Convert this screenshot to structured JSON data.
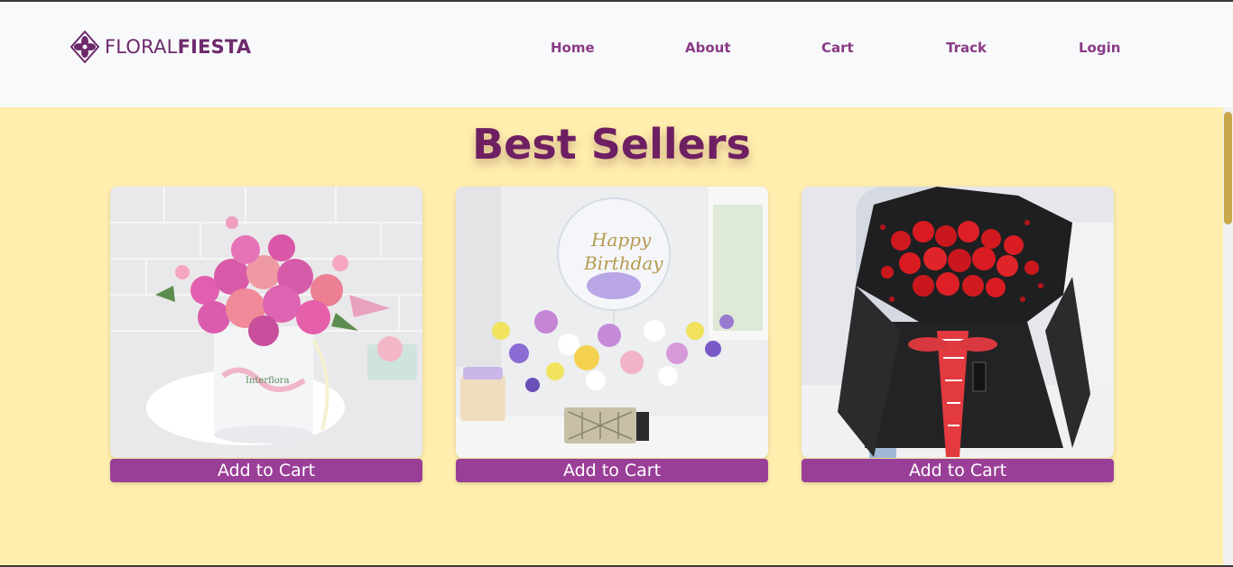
{
  "brand": {
    "name_light": "FLORAL",
    "name_bold": "FIESTA",
    "logo_icon": "flower-diamond-icon",
    "color": "#6d2a6b"
  },
  "nav": {
    "items": [
      {
        "label": "Home"
      },
      {
        "label": "About"
      },
      {
        "label": "Cart"
      },
      {
        "label": "Track"
      },
      {
        "label": "Login"
      }
    ]
  },
  "best_sellers": {
    "title": "Best Sellers",
    "background": "#ffeeae",
    "title_color": "#6e1f62",
    "products": [
      {
        "image": "pink-roses-box-bouquet",
        "button_label": "Add to Cart"
      },
      {
        "image": "birthday-balloon-flower-basket",
        "button_label": "Add to Cart"
      },
      {
        "image": "red-roses-black-wrap-bouquet",
        "button_label": "Add to Cart"
      }
    ],
    "button_color": "#9a3f98"
  },
  "scrollbar": {
    "thumb_color": "#c8a848"
  }
}
